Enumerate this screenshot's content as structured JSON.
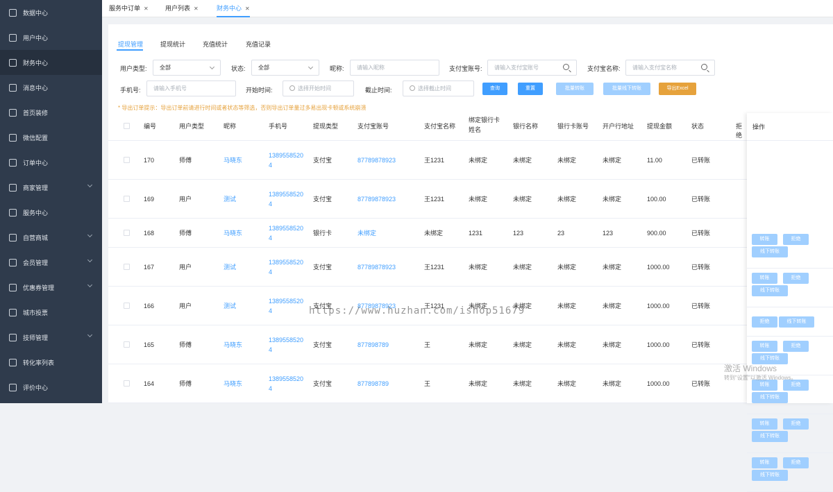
{
  "sidebar": {
    "items": [
      {
        "label": "数据中心",
        "icon": "chart-icon",
        "arrow": false
      },
      {
        "label": "用户中心",
        "icon": "user-icon",
        "arrow": false
      },
      {
        "label": "财务中心",
        "icon": "wallet-icon",
        "arrow": false,
        "active": true
      },
      {
        "label": "消息中心",
        "icon": "message-icon",
        "arrow": false
      },
      {
        "label": "首页装修",
        "icon": "cube-icon",
        "arrow": false
      },
      {
        "label": "微信配置",
        "icon": "document-icon",
        "arrow": false
      },
      {
        "label": "订单中心",
        "icon": "order-icon",
        "arrow": false
      },
      {
        "label": "商家管理",
        "icon": "store-icon",
        "arrow": true
      },
      {
        "label": "服务中心",
        "icon": "clipboard-icon",
        "arrow": false
      },
      {
        "label": "自营商城",
        "icon": "bag-icon",
        "arrow": true
      },
      {
        "label": "会员管理",
        "icon": "member-icon",
        "arrow": true
      },
      {
        "label": "优惠券管理",
        "icon": "coupon-icon",
        "arrow": true
      },
      {
        "label": "城市投票",
        "icon": "vote-icon",
        "arrow": false
      },
      {
        "label": "技师管理",
        "icon": "technician-icon",
        "arrow": true
      },
      {
        "label": "转化率列表",
        "icon": "conversion-icon",
        "arrow": false
      },
      {
        "label": "评价中心",
        "icon": "comment-icon",
        "arrow": false
      }
    ]
  },
  "tabs": [
    {
      "label": "服务中订单",
      "close": "✕"
    },
    {
      "label": "用户列表",
      "close": "✕"
    },
    {
      "label": "财务中心",
      "close": "✕",
      "active": true
    }
  ],
  "subtabs": [
    "提现管理",
    "提现统计",
    "充值统计",
    "充值记录"
  ],
  "filters": {
    "user_type_label": "用户类型:",
    "user_type_value": "全部",
    "status_label": "状态:",
    "status_value": "全部",
    "nickname_label": "昵称:",
    "nickname_placeholder": "请输入昵称",
    "alipay_account_label": "支付宝账号:",
    "alipay_account_placeholder": "请输入支付宝账号",
    "alipay_name_label": "支付宝名称:",
    "alipay_name_placeholder": "请输入支付宝名称",
    "phone_label": "手机号:",
    "phone_placeholder": "请输入手机号",
    "start_label": "开始时间:",
    "start_placeholder": "选择开始时间",
    "end_label": "截止时间:",
    "end_placeholder": "选择截止时间"
  },
  "buttons": {
    "query": "查询",
    "reset": "重置",
    "batch_transfer": "批量转账",
    "batch_offline": "批量线下转账",
    "export": "导出Excel"
  },
  "tip": "* 导出订单提示：导出订单前请进行时间或者状态等筛选，否则导出订单量过多易出现卡顿或系统崩溃",
  "columns": [
    "编号",
    "用户类型",
    "昵称",
    "手机号",
    "提现类型",
    "支付宝账号",
    "支付宝名称",
    "绑定银行卡姓名",
    "银行名称",
    "银行卡账号",
    "开户行地址",
    "提现金额",
    "状态",
    "拒绝",
    "操作"
  ],
  "column_head_lines": {
    "bank_name_1": "绑定银行卡",
    "bank_name_2": "姓名"
  },
  "rows": [
    {
      "id": "170",
      "type": "师傅",
      "nick": "马晓东",
      "phone1": "1389558520",
      "phone2": "4",
      "wtype": "支付宝",
      "acct": "87789878923",
      "aname": "王1231",
      "bname": "未绑定",
      "bank": "未绑定",
      "card": "未绑定",
      "addr": "未绑定",
      "amount": "11.00",
      "status": "已转账",
      "ops": [
        "转账",
        "拒绝",
        "线下转账"
      ]
    },
    {
      "id": "169",
      "type": "用户",
      "nick": "测试",
      "phone1": "1389558520",
      "phone2": "4",
      "wtype": "支付宝",
      "acct": "87789878923",
      "aname": "王1231",
      "bname": "未绑定",
      "bank": "未绑定",
      "card": "未绑定",
      "addr": "未绑定",
      "amount": "100.00",
      "status": "已转账",
      "ops": [
        "转账",
        "拒绝",
        "线下转账"
      ]
    },
    {
      "id": "168",
      "type": "师傅",
      "nick": "马晓东",
      "phone1": "1389558520",
      "phone2": "4",
      "wtype": "银行卡",
      "acct": "未绑定",
      "aname": "未绑定",
      "bname": "1231",
      "bank": "123",
      "card": "23",
      "addr": "123",
      "amount": "900.00",
      "status": "已转账",
      "ops": [
        "拒绝",
        "线下转账"
      ]
    },
    {
      "id": "167",
      "type": "用户",
      "nick": "测试",
      "phone1": "1389558520",
      "phone2": "4",
      "wtype": "支付宝",
      "acct": "87789878923",
      "aname": "王1231",
      "bname": "未绑定",
      "bank": "未绑定",
      "card": "未绑定",
      "addr": "未绑定",
      "amount": "1000.00",
      "status": "已转账",
      "ops": [
        "转账",
        "拒绝",
        "线下转账"
      ]
    },
    {
      "id": "166",
      "type": "用户",
      "nick": "测试",
      "phone1": "1389558520",
      "phone2": "4",
      "wtype": "支付宝",
      "acct": "87789878923",
      "aname": "王1231",
      "bname": "未绑定",
      "bank": "未绑定",
      "card": "未绑定",
      "addr": "未绑定",
      "amount": "1000.00",
      "status": "已转账",
      "ops": [
        "转账",
        "拒绝",
        "线下转账"
      ]
    },
    {
      "id": "165",
      "type": "师傅",
      "nick": "马晓东",
      "phone1": "1389558520",
      "phone2": "4",
      "wtype": "支付宝",
      "acct": "877898789",
      "aname": "王",
      "bname": "未绑定",
      "bank": "未绑定",
      "card": "未绑定",
      "addr": "未绑定",
      "amount": "1000.00",
      "status": "已转账",
      "ops": [
        "转账",
        "拒绝",
        "线下转账"
      ]
    },
    {
      "id": "164",
      "type": "师傅",
      "nick": "马晓东",
      "phone1": "1389558520",
      "phone2": "4",
      "wtype": "支付宝",
      "acct": "877898789",
      "aname": "王",
      "bname": "未绑定",
      "bank": "未绑定",
      "card": "未绑定",
      "addr": "未绑定",
      "amount": "1000.00",
      "status": "已转账",
      "ops": [
        "转账",
        "拒绝",
        "线下转账"
      ]
    }
  ],
  "watermark": "https://www.huzhan.com/ishop51679",
  "activation": {
    "line1": "激活 Windows",
    "line2": "转到\"设置\"以激活 Windows。"
  },
  "colors": {
    "accent": "#409eff",
    "accent_light": "#a0cfff",
    "warning": "#e6a23c",
    "sidebar": "#2f3b4c"
  }
}
